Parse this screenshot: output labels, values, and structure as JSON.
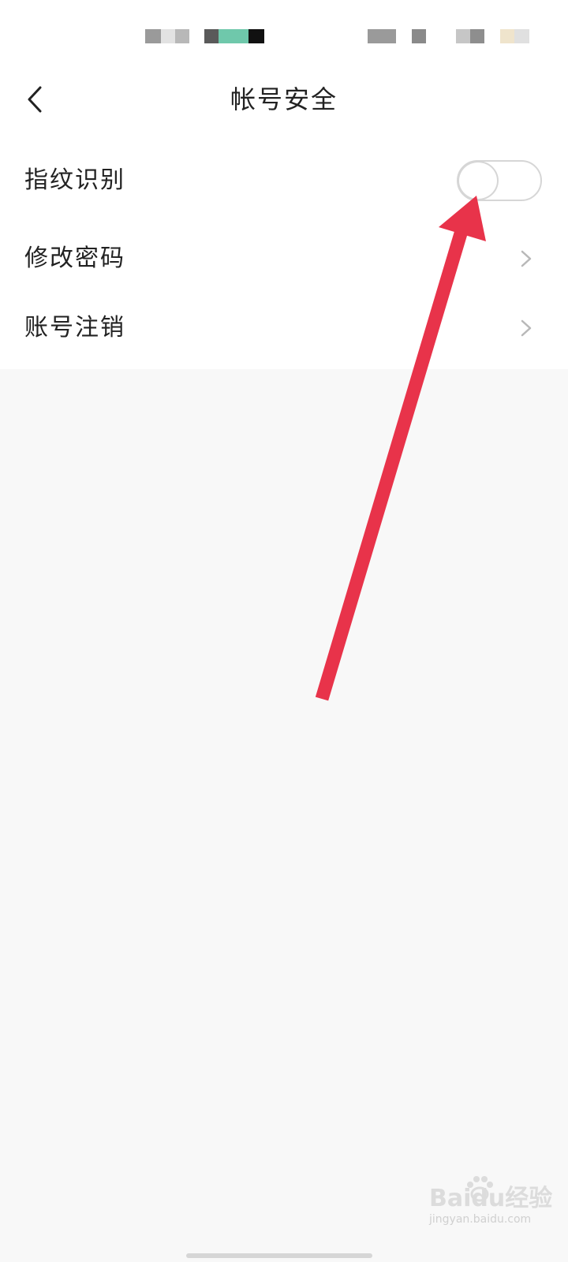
{
  "header": {
    "title": "帐号安全",
    "back_icon": "chevron-left-icon"
  },
  "settings": {
    "rows": [
      {
        "label": "指纹识别",
        "control": "toggle",
        "toggle_on": false
      },
      {
        "label": "修改密码",
        "control": "chevron",
        "icon": "chevron-right-icon"
      },
      {
        "label": "账号注销",
        "control": "chevron",
        "icon": "chevron-right-icon"
      }
    ]
  },
  "watermark": {
    "brand": "Baidu经验",
    "url": "jingyan.baidu.com"
  },
  "colors": {
    "annotation_arrow": "#e8334a",
    "background": "#f8f8f8",
    "panel": "#ffffff",
    "toggle_border": "#d6d6d6"
  }
}
